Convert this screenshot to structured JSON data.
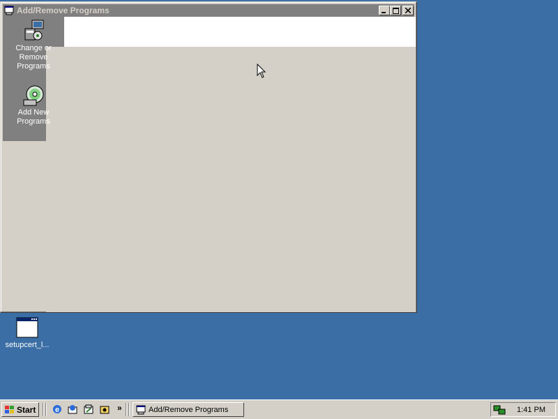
{
  "window": {
    "title": "Add/Remove Programs",
    "title_icon": "add-remove-programs-icon",
    "controls": {
      "minimize": "minimize-icon",
      "maximize": "maximize-icon",
      "close": "close-icon"
    },
    "sidebar": {
      "items": [
        {
          "label": "Change or\nRemove\nPrograms",
          "icon": "install-box-icon"
        },
        {
          "label": "Add New\nPrograms",
          "icon": "cd-icon"
        }
      ]
    }
  },
  "desktop": {
    "icons": [
      {
        "label": "setupcert_l...",
        "icon": "window-app-icon"
      }
    ]
  },
  "taskbar": {
    "start_label": "Start",
    "quicklaunch": [
      "internet-explorer-icon",
      "outlook-express-icon",
      "show-desktop-icon",
      "windows-explorer-icon"
    ],
    "overflow": "»",
    "tasks": [
      {
        "label": "Add/Remove Programs",
        "icon": "add-remove-programs-icon"
      }
    ],
    "tray": {
      "icon": "network-icon",
      "clock": "1:41 PM"
    }
  }
}
